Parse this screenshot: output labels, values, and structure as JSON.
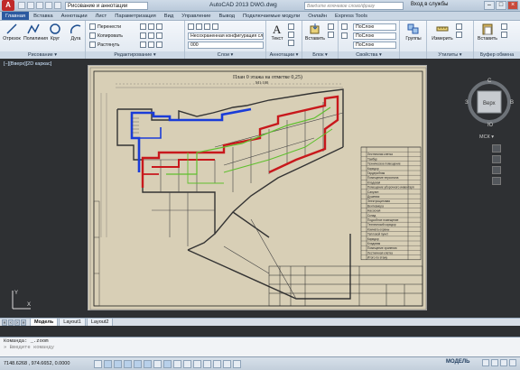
{
  "app": {
    "title": "AutoCAD 2013    DWG.dwg",
    "workspace": "Рисование и аннотации",
    "search_placeholder": "Введите ключевое слово/фразу",
    "signin": "Вход в службы",
    "menu_button": "A"
  },
  "tabs": [
    "Главная",
    "Вставка",
    "Аннотации",
    "Лист",
    "Параметризация",
    "Вид",
    "Управление",
    "Вывод",
    "Подключаемые модули",
    "Онлайн",
    "Express Tools"
  ],
  "ribbon": {
    "draw": {
      "title": "Рисование ▾",
      "tools": [
        "Отрезок",
        "Полилиния",
        "Круг",
        "Дуга"
      ]
    },
    "modify": {
      "title": "Редактирование ▾",
      "rows": [
        "Перенести",
        "Копировать",
        "Растянуть"
      ],
      "rows2": [
        "",
        "",
        ""
      ]
    },
    "layers": {
      "title": "Слои ▾",
      "combo1": "Несохраненная конфигурация сло",
      "combo2": "000"
    },
    "annotation": {
      "title": "Аннотации ▾",
      "big": "Текст"
    },
    "block": {
      "title": "Блок ▾",
      "big": "Вставить"
    },
    "properties": {
      "title": "Свойства ▾",
      "c1": "ПоСлою",
      "c2": "ПоСлою",
      "c3": "ПоСлою"
    },
    "groups": {
      "title": "",
      "big": "Группы"
    },
    "utilities": {
      "title": "Утилиты ▾",
      "big": "Измерить"
    },
    "clipboard": {
      "title": "Буфер обмена",
      "big": "Вставить"
    }
  },
  "viewport": {
    "label": "[−][Вверх][2D каркас]",
    "plan_title": "План 0 этажа на отметке  0,25)",
    "plan_scale": "М1:100"
  },
  "viewcube": {
    "face": "Верх",
    "north": "С",
    "south": "Ю",
    "west": "З",
    "east": "В",
    "wcs": "МСК ▾"
  },
  "legend_rows": [
    "Лестничная клетка",
    "Тамбур",
    "Техническое помещение",
    "Коридор",
    "Гардеробная",
    "Помещение персонала",
    "Кладовая",
    "Помещение уборочного инвентаря",
    "Санузел",
    "Душевая",
    "Электрощитовая",
    "Венткамера",
    "Насосная",
    "Склад",
    "Подсобное помещение",
    "Технический коридор",
    "Комната охраны",
    "Тепловой пункт",
    "Коридор",
    "Кладовая",
    "Помещение хранения",
    "Лестничная клетка",
    "Итого по этажу"
  ],
  "layout_tabs": {
    "model": "Модель",
    "l1": "Layout1",
    "l2": "Layout2"
  },
  "command": {
    "line1": "Команда: _.zoom",
    "line2": "»  Введите команду"
  },
  "status": {
    "coords": "7148.6268 , 974.6652, 0.0000",
    "mode": "МОДЕЛЬ"
  },
  "colors": {
    "red": "#c8181c",
    "blue": "#1a3cd8",
    "green": "#5fbf2e",
    "paper": "#d8cfb6"
  }
}
